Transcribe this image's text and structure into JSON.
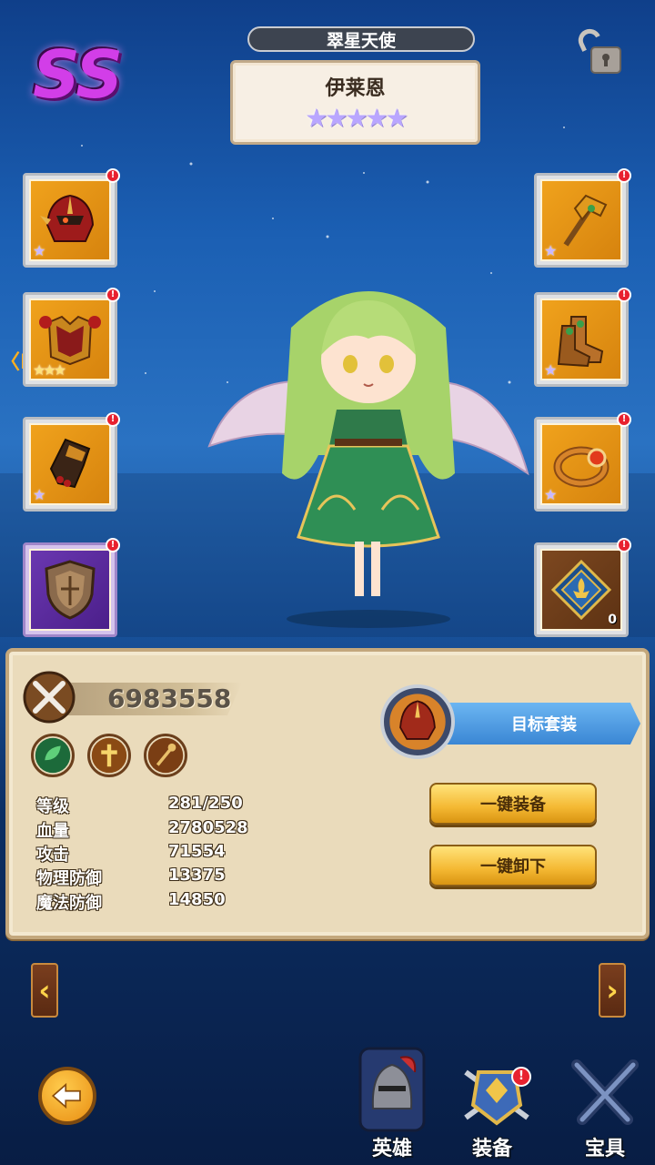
{
  "header": {
    "rank": "SS",
    "title": "翠星天使",
    "hero_name": "伊莱恩",
    "stars": "★★★★★"
  },
  "side_tag": "〈D",
  "equipment": {
    "left": [
      {
        "name": "helmet",
        "stars": "★",
        "star_color": "purple",
        "badge": "!"
      },
      {
        "name": "armor",
        "stars": "★★★",
        "star_color": "gold",
        "badge": "!"
      },
      {
        "name": "gloves",
        "stars": "★",
        "star_color": "purple",
        "badge": "!"
      },
      {
        "name": "shield",
        "stars": "",
        "star_color": "purple",
        "badge": "!"
      }
    ],
    "right": [
      {
        "name": "weapon",
        "stars": "★",
        "star_color": "purple",
        "badge": "!"
      },
      {
        "name": "boots",
        "stars": "★",
        "star_color": "purple",
        "badge": "!"
      },
      {
        "name": "ring",
        "stars": "★",
        "star_color": "purple",
        "badge": "!"
      },
      {
        "name": "emblem",
        "stars": "",
        "count": "0",
        "badge": "!"
      }
    ]
  },
  "stats_panel": {
    "power": "6983558",
    "target_set_label": "目标套装",
    "equip_all_label": "一键装备",
    "unequip_all_label": "一键卸下",
    "stats": [
      {
        "label": "等级",
        "value": "281/250"
      },
      {
        "label": "血量",
        "value": "2780528"
      },
      {
        "label": "攻击",
        "value": "71554"
      },
      {
        "label": "物理防御",
        "value": "13375"
      },
      {
        "label": "魔法防御",
        "value": "14850"
      }
    ]
  },
  "nav": {
    "left_arrow": "‹",
    "right_arrow": "›",
    "tabs": [
      {
        "label": "英雄"
      },
      {
        "label": "装备",
        "badge": "!"
      },
      {
        "label": "宝具"
      }
    ]
  },
  "colors": {
    "rank": "#d23ee8",
    "panel": "#eadbbb",
    "gold_button": "#f4b832",
    "target_button": "#3a86d4"
  }
}
